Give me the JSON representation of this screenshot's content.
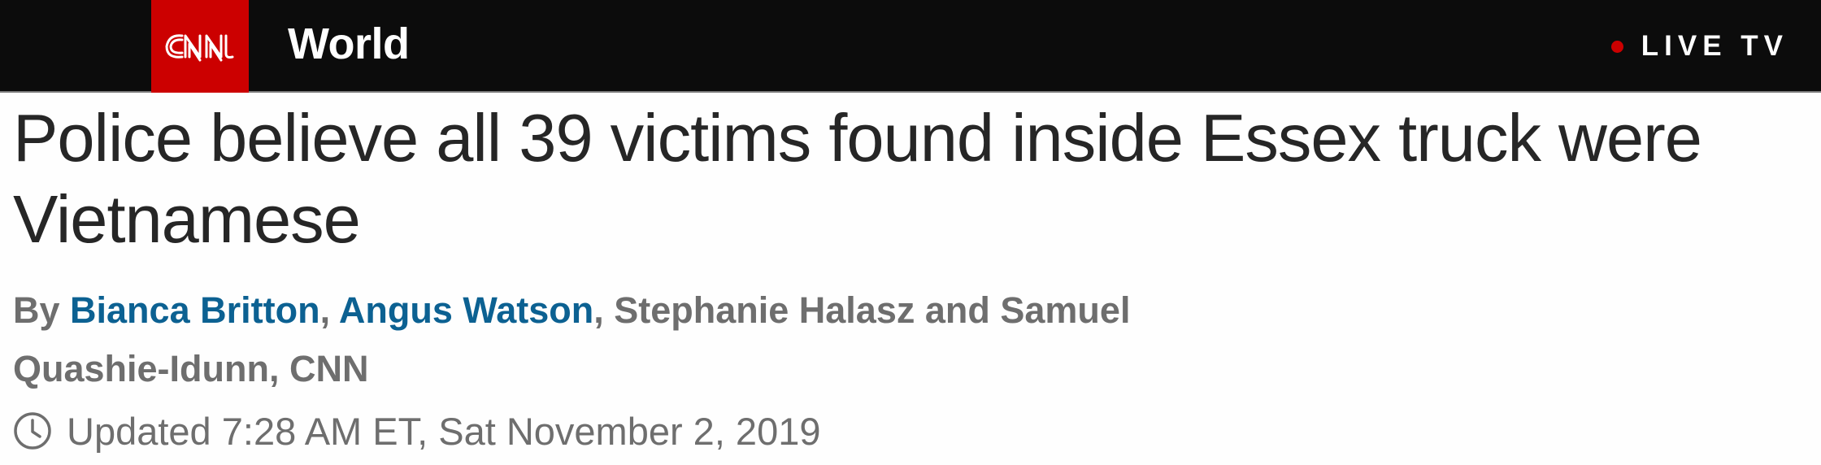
{
  "header": {
    "logo_text": "CNN",
    "section_label": "World",
    "live_label": "LIVE TV",
    "brand_red": "#cc0000",
    "bar_color": "#0c0c0c"
  },
  "article": {
    "headline": "Police believe all 39 victims found inside Essex truck were Vietnamese",
    "byline": {
      "prefix": "By ",
      "linked_authors": [
        "Bianca Britton",
        "Angus Watson"
      ],
      "sep_1": ", ",
      "sep_2": ", ",
      "rest": "Stephanie Halasz and Samuel Quashie-Idunn, CNN",
      "link_color": "#0c6192"
    },
    "timestamp": "Updated 7:28 AM ET, Sat November 2, 2019",
    "timestamp_icon": "clock-icon"
  }
}
